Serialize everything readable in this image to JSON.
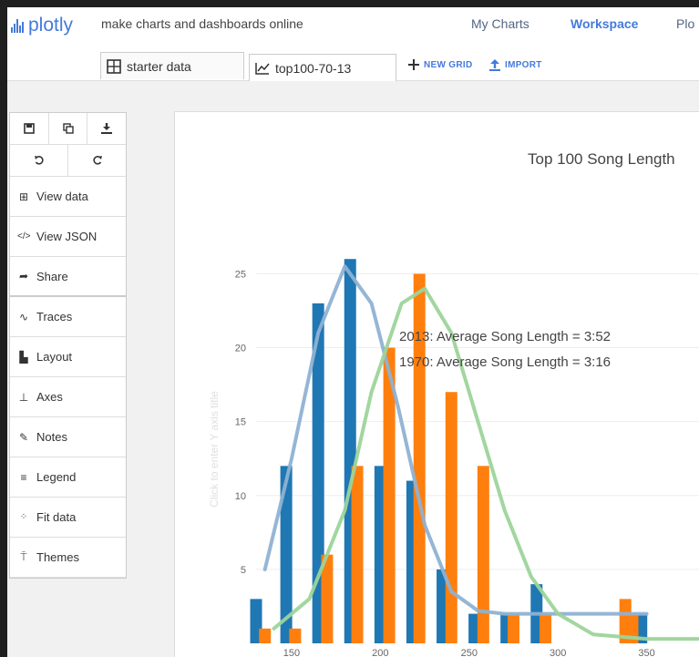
{
  "header": {
    "brand": "plotly",
    "tagline": "make charts and dashboards online",
    "nav": [
      "My Charts",
      "Workspace",
      "Plo"
    ]
  },
  "tabs": [
    {
      "label": "starter data",
      "icon": "grid-icon"
    },
    {
      "label": "top100-70-13",
      "icon": "line-chart-icon"
    }
  ],
  "toolbar": {
    "new_grid": "NEW GRID",
    "import": "IMPORT"
  },
  "sidebar": {
    "icons_row1": [
      "save-icon",
      "copy-icon",
      "download-icon"
    ],
    "icons_row2": [
      "undo-icon",
      "redo-icon"
    ],
    "items": [
      {
        "label": "View data",
        "icon": "grid-icon"
      },
      {
        "label": "View JSON",
        "icon": "code-icon"
      },
      {
        "label": "Share",
        "icon": "share-icon"
      },
      {
        "label": "Traces",
        "icon": "traces-icon"
      },
      {
        "label": "Layout",
        "icon": "layout-icon"
      },
      {
        "label": "Axes",
        "icon": "axes-icon"
      },
      {
        "label": "Notes",
        "icon": "notes-icon"
      },
      {
        "label": "Legend",
        "icon": "legend-icon"
      },
      {
        "label": "Fit data",
        "icon": "fit-icon"
      },
      {
        "label": "Themes",
        "icon": "themes-icon"
      }
    ]
  },
  "chart_data": {
    "type": "bar",
    "title": "Top 100 Song Length",
    "ylabel_placeholder": "Click to enter Y axis title",
    "xlim": [
      130,
      380
    ],
    "ylim": [
      0,
      27
    ],
    "xticks": [
      150,
      200,
      250,
      300,
      350
    ],
    "yticks": [
      5,
      10,
      15,
      20,
      25
    ],
    "colors": {
      "blue": "#1f77b4",
      "orange": "#ff7f0e",
      "blue_fit": "#8fb2d3",
      "green_fit": "#9dd49a"
    },
    "series": [
      {
        "color": "blue",
        "x": [
          130,
          147,
          165,
          183,
          200,
          218,
          235,
          253,
          271,
          288,
          342,
          347
        ],
        "values": [
          3,
          12,
          23,
          26,
          12,
          11,
          5,
          2,
          2,
          4,
          2,
          2
        ]
      },
      {
        "color": "orange",
        "x": [
          135,
          152,
          170,
          187,
          205,
          222,
          240,
          258,
          275,
          293,
          338,
          342
        ],
        "values": [
          1,
          1,
          6,
          12,
          20,
          25,
          17,
          12,
          2,
          2,
          3,
          2
        ]
      }
    ],
    "fits": [
      {
        "color": "blue_fit",
        "points": [
          [
            135,
            5
          ],
          [
            150,
            12.5
          ],
          [
            165,
            21
          ],
          [
            180,
            25.5
          ],
          [
            195,
            23
          ],
          [
            210,
            16
          ],
          [
            225,
            8
          ],
          [
            240,
            3.5
          ],
          [
            255,
            2.2
          ],
          [
            270,
            2
          ],
          [
            300,
            2
          ],
          [
            350,
            2
          ]
        ]
      },
      {
        "color": "green_fit",
        "points": [
          [
            140,
            1
          ],
          [
            160,
            3
          ],
          [
            180,
            9
          ],
          [
            195,
            17
          ],
          [
            212,
            23
          ],
          [
            225,
            24
          ],
          [
            240,
            21
          ],
          [
            255,
            15
          ],
          [
            270,
            9
          ],
          [
            285,
            4.5
          ],
          [
            300,
            2
          ],
          [
            320,
            0.6
          ],
          [
            350,
            0.3
          ],
          [
            380,
            0.3
          ]
        ]
      }
    ],
    "annotations": [
      "2013: Average Song Length = 3:52",
      "1970: Average Song Length = 3:16"
    ]
  }
}
